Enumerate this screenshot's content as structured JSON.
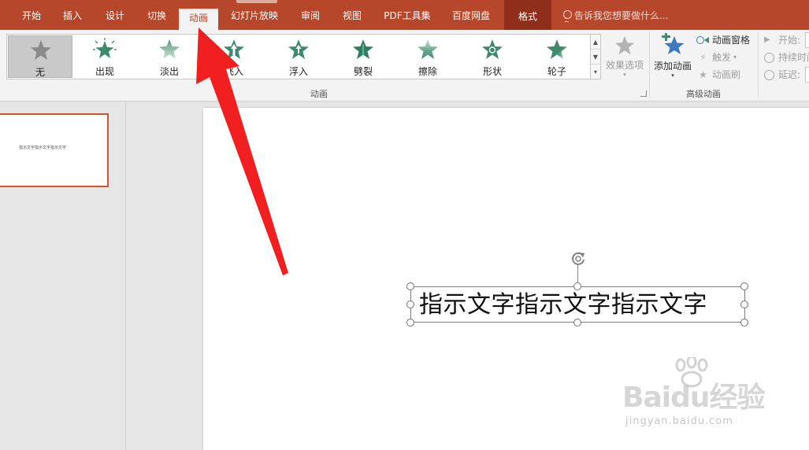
{
  "tabs": [
    {
      "label": "开始",
      "active": false
    },
    {
      "label": "插入",
      "active": false
    },
    {
      "label": "设计",
      "active": false
    },
    {
      "label": "切换",
      "active": false
    },
    {
      "label": "动画",
      "active": true
    },
    {
      "label": "幻灯片放映",
      "active": false
    },
    {
      "label": "审阅",
      "active": false
    },
    {
      "label": "视图",
      "active": false
    },
    {
      "label": "PDF工具集",
      "active": false
    },
    {
      "label": "百度网盘",
      "active": false
    },
    {
      "label": "格式",
      "active": false,
      "contextual": true
    }
  ],
  "tell_me": {
    "text": "告诉我您想要做什么...",
    "icon": "lightbulb-icon"
  },
  "animation_gallery": {
    "items": [
      {
        "label": "无",
        "icon": "star-none-icon",
        "selected": true
      },
      {
        "label": "出现",
        "icon": "star-appear-icon",
        "selected": false
      },
      {
        "label": "淡出",
        "icon": "star-fade-icon",
        "selected": false
      },
      {
        "label": "飞入",
        "icon": "star-fly-in-icon",
        "selected": false
      },
      {
        "label": "浮入",
        "icon": "star-float-in-icon",
        "selected": false
      },
      {
        "label": "劈裂",
        "icon": "star-split-icon",
        "selected": false
      },
      {
        "label": "擦除",
        "icon": "star-wipe-icon",
        "selected": false
      },
      {
        "label": "形状",
        "icon": "star-shape-icon",
        "selected": false
      },
      {
        "label": "轮子",
        "icon": "star-wheel-icon",
        "selected": false
      }
    ],
    "group_label": "动画"
  },
  "effect_options": {
    "label": "效果选项",
    "disabled": true
  },
  "advanced_animation": {
    "add_animation_label": "添加动画",
    "animation_pane_label": "动画窗格",
    "trigger_label": "触发",
    "animation_painter_label": "动画刷",
    "group_label": "高级动画"
  },
  "timing": {
    "start_label": "开始:",
    "duration_label": "持续时间",
    "delay_label": "延迟:"
  },
  "slide": {
    "thumbnail_text": "指示文字指示文字指示文字",
    "textbox_text": "指示文字指示文字指示文字"
  },
  "watermark": {
    "line1": "Baidu经验",
    "line2": "jingyan.baidu.com"
  },
  "colors": {
    "accent": "#b7472a",
    "arrow": "#f11f1f",
    "gallery_star": "#5b9e84"
  }
}
